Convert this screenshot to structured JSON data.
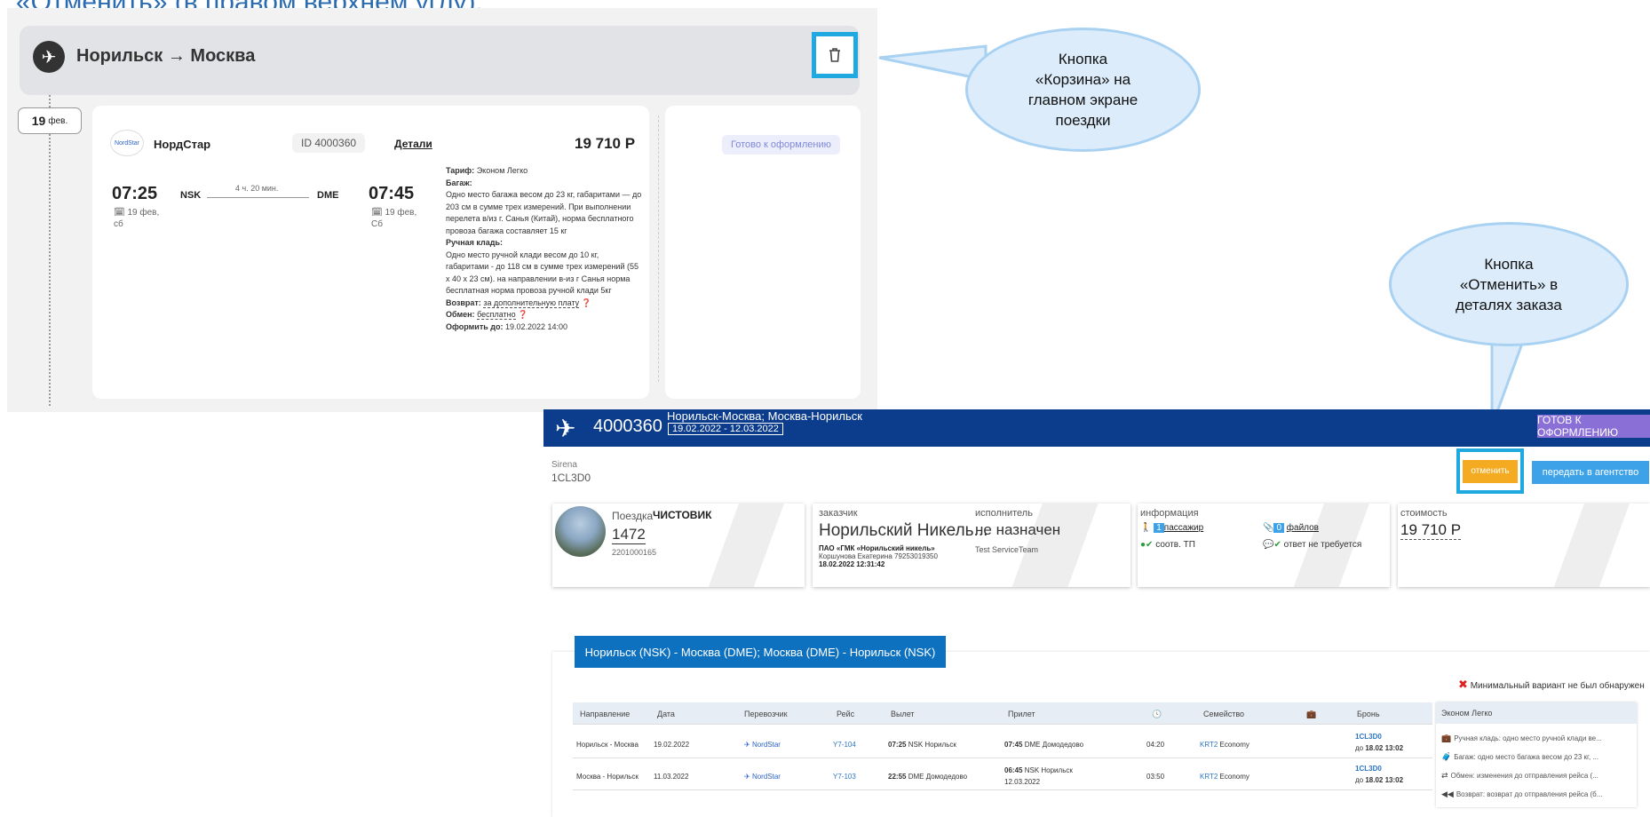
{
  "top_cut_text": "«Отменить» (в правом верхнем углу).",
  "trip_card": {
    "route_title": "Норильск → Москва",
    "date_day": "19",
    "date_month": "фев.",
    "airline_logo": "NordStar",
    "airline": "НордСтар",
    "order_id": "ID 4000360",
    "details_link": "Детали",
    "price": "19 710 Р",
    "status_badge": "Готово к оформлению",
    "departure_time": "07:25",
    "departure_code": "NSK",
    "duration": "4 ч. 20 мин.",
    "arrival_code": "DME",
    "arrival_time": "07:45",
    "departure_date": "19 фев, сб",
    "arrival_date": "19 фев, Сб",
    "tariff_label": "Тариф:",
    "tariff_value": "Эконом Легко",
    "baggage_label": "Багаж:",
    "baggage_text": "Одно место багажа весом до 23 кг, габаритами — до 203 см в сумме трех измерений. При выполнении перелета в/из г. Санья (Китай), норма бесплатного провоза багажа составляет 15 кг",
    "hand_label": "Ручная кладь:",
    "hand_text": "Одно место ручной клади весом до 10 кг, габаритами - до 118 см в сумме трех измерений (55 х 40 х 23 см). на направлении в-из г Санья норма бесплатная норма провоза ручной клади 5кг",
    "refund_label": "Возврат:",
    "refund_value": "за дополнительную плату",
    "exchange_label": "Обмен:",
    "exchange_value": "бесплатно",
    "deadline_label": "Оформить до:",
    "deadline_value": "19.02.2022 14:00"
  },
  "callouts": {
    "cart": "Кнопка «Корзина» на главном экране поездки",
    "cancel": "Кнопка «Отменить» в деталях заказа"
  },
  "order": {
    "number": "4000360",
    "route": "Норильск-Москва; Москва-Норильск",
    "dates": "19.02.2022 - 12.03.2022",
    "status_button": "ГОТОВ К ОФОРМЛЕНИЮ",
    "gds": "Sirena",
    "pnr": "1CL3D0",
    "cancel_button": "отменить",
    "agency_button": "передать в агентство",
    "trip_label": "Поездка",
    "trip_status": "ЧИСТОВИК",
    "trip_number": "1472",
    "trip_code": "2201000165",
    "customer_label": "заказчик",
    "customer_name": "Норильский Никель...",
    "customer_org": "ПАО «ГМК «Норильский никель»",
    "customer_contact": "Коршунова Екатерина  79253019350",
    "customer_timestamp": "18.02.2022 12:31:42",
    "executor_label": "исполнитель",
    "executor_name": "не назначен",
    "executor_team": "Test ServiceTeam",
    "info_label": "информация",
    "passenger_count": "1",
    "passenger_link": "пассажир",
    "tp_text": "соотв. ТП",
    "files_count": "0",
    "files_link": "файлов",
    "answer_text": "ответ не требуется",
    "cost_label": "стоимость",
    "cost_value": "19 710 Р"
  },
  "segments": {
    "tab_label": "Норильск (NSK) - Москва (DME); Москва (DME) - Норильск (NSK)",
    "min_variant": "Минимальный вариант не был обнаружен",
    "headers": [
      "Направление",
      "Дата",
      "Перевозчик",
      "Рейс",
      "Вылет",
      "Прилет",
      "Семейство",
      "Бронь"
    ],
    "rows": [
      {
        "direction": "Норильск - Москва",
        "date": "19.02.2022",
        "carrier": "NordStar",
        "flight": "Y7-104",
        "dep_time": "07:25",
        "dep_place": "NSK Норильск",
        "arr_time": "07:45",
        "arr_place": "DME Домодедово",
        "arr_date": "",
        "duration": "04:20",
        "family_code": "KRT2",
        "family_name": "Economy",
        "pnr": "1CL3D0",
        "pnr_until_label": "до",
        "pnr_until": "18.02 13:02"
      },
      {
        "direction": "Москва - Норильск",
        "date": "11.03.2022",
        "carrier": "NordStar",
        "flight": "Y7-103",
        "dep_time": "22:55",
        "dep_place": "DME Домодедово",
        "arr_time": "06:45",
        "arr_place": "NSK Норильск",
        "arr_date": "12.03.2022",
        "duration": "03:50",
        "family_code": "KRT2",
        "family_name": "Economy",
        "pnr": "1CL3D0",
        "pnr_until_label": "до",
        "pnr_until": "18.02 13:02"
      }
    ],
    "fare_title": "Эконом Легко",
    "fare_items": [
      "Ручная кладь: одно место ручной клади ве...",
      "Багаж: одно место багажа весом до 23 кг, ...",
      "Обмен: изменения до отправления рейса (...",
      "Возврат: возврат до отправления рейса (б..."
    ]
  }
}
